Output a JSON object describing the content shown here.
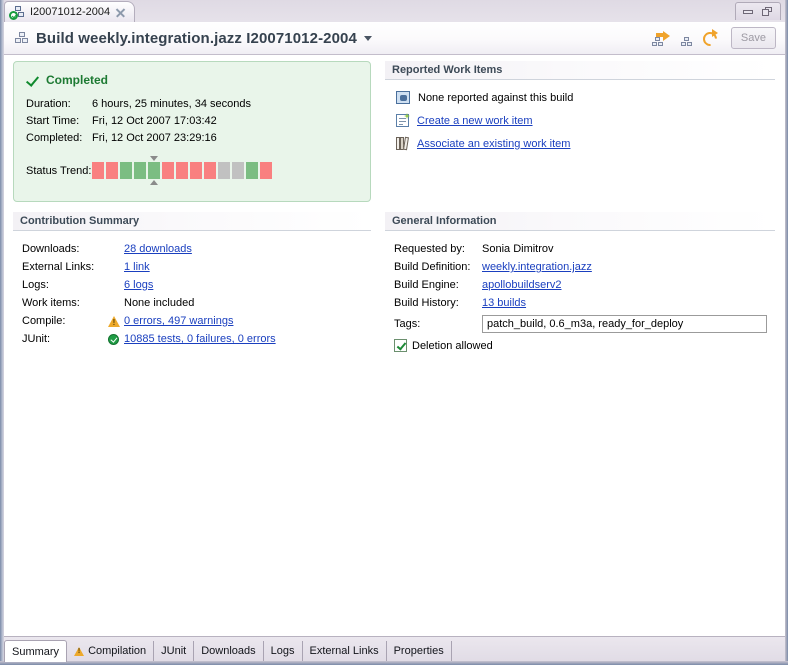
{
  "window": {
    "minimize_label": "Minimize",
    "maximize_label": "Restore"
  },
  "editor_tab": {
    "icon": "build-icon",
    "label": "I20071012-2004",
    "close_icon": "close-icon"
  },
  "header": {
    "icon": "build-icon",
    "title": "Build weekly.integration.jazz I20071012-2004",
    "caret_icon": "chevron-down-icon",
    "tools": [
      {
        "name": "request-build-icon"
      },
      {
        "name": "build-definition-icon"
      },
      {
        "name": "refresh-icon"
      }
    ],
    "save_label": "Save"
  },
  "status_panel": {
    "status_icon": "check-icon",
    "status_label": "Completed",
    "rows": [
      {
        "key": "Duration:",
        "value": "6 hours, 25 minutes, 34 seconds"
      },
      {
        "key": "Start Time:",
        "value": "Fri, 12 Oct 2007 17:03:42"
      },
      {
        "key": "Completed:",
        "value": "Fri, 12 Oct 2007 23:29:16"
      }
    ],
    "trend_label": "Status Trend:",
    "trend": [
      {
        "state": "fail",
        "current": false
      },
      {
        "state": "fail",
        "current": false
      },
      {
        "state": "pass",
        "current": false
      },
      {
        "state": "pass",
        "current": false
      },
      {
        "state": "pass",
        "current": true
      },
      {
        "state": "fail",
        "current": false
      },
      {
        "state": "fail",
        "current": false
      },
      {
        "state": "fail",
        "current": false
      },
      {
        "state": "fail",
        "current": false
      },
      {
        "state": "none",
        "current": false
      },
      {
        "state": "none",
        "current": false
      },
      {
        "state": "pass",
        "current": false
      },
      {
        "state": "fail",
        "current": false
      }
    ]
  },
  "work_items_panel": {
    "title": "Reported Work Items",
    "rows": [
      {
        "icon": "work-item-icon",
        "text": "None reported against this build",
        "link": false
      },
      {
        "icon": "new-work-item-icon",
        "text": "Create a new work item",
        "link": true
      },
      {
        "icon": "associate-work-item-icon",
        "text": "Associate an existing work item",
        "link": true
      }
    ]
  },
  "contribution_panel": {
    "title": "Contribution Summary",
    "rows": [
      {
        "key": "Downloads:",
        "status": "none",
        "value": "28 downloads",
        "link": true
      },
      {
        "key": "External Links:",
        "status": "none",
        "value": "1 link",
        "link": true
      },
      {
        "key": "Logs:",
        "status": "none",
        "value": "6 logs",
        "link": true
      },
      {
        "key": "Work items:",
        "status": "none",
        "value": "None included",
        "link": false
      },
      {
        "key": "Compile:",
        "status": "warning",
        "value": "0 errors, 497 warnings",
        "link": true
      },
      {
        "key": "JUnit:",
        "status": "ok",
        "value": "10885 tests, 0 failures, 0 errors",
        "link": true
      }
    ]
  },
  "general_panel": {
    "title": "General Information",
    "rows": [
      {
        "key": "Requested by:",
        "value": "Sonia Dimitrov",
        "link": false
      },
      {
        "key": "Build Definition:",
        "value": "weekly.integration.jazz",
        "link": true
      },
      {
        "key": "Build Engine:",
        "value": "apollobuildserv2",
        "link": true
      },
      {
        "key": "Build History:",
        "value": "13 builds",
        "link": true
      }
    ],
    "tags_label": "Tags:",
    "tags_value": "patch_build, 0.6_m3a, ready_for_deploy",
    "tags_placeholder": "",
    "deletion_label": "Deletion allowed",
    "deletion_checked": true
  },
  "bottom_tabs": [
    {
      "label": "Summary",
      "active": true,
      "icon": null
    },
    {
      "label": "Compilation",
      "active": false,
      "icon": "warning-icon"
    },
    {
      "label": "JUnit",
      "active": false,
      "icon": null
    },
    {
      "label": "Downloads",
      "active": false,
      "icon": null
    },
    {
      "label": "Logs",
      "active": false,
      "icon": null
    },
    {
      "label": "External Links",
      "active": false,
      "icon": null
    },
    {
      "label": "Properties",
      "active": false,
      "icon": null
    }
  ],
  "colors": {
    "status_green": "#1d7a33",
    "link_blue": "#1a3fbf",
    "trend_fail": "#f98080",
    "trend_pass": "#7bbd82",
    "trend_none": "#c1c1c1",
    "warning_amber": "#eda92b"
  }
}
